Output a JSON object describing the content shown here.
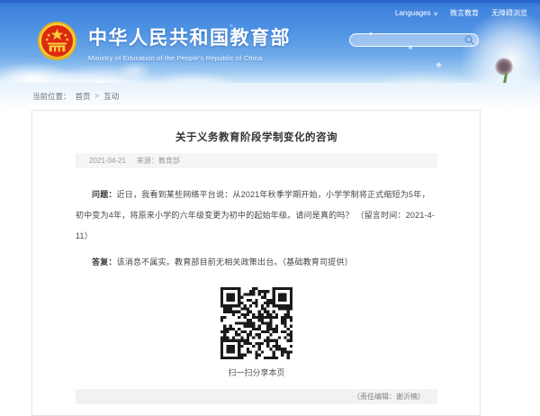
{
  "header": {
    "site_title": "中华人民共和国教育部",
    "site_subtitle": "Ministry of Education of the People's Republic of China",
    "links": {
      "languages": "Languages",
      "weiyan": "微言教育",
      "accessibility": "无障碍浏览"
    },
    "search": {
      "value": "",
      "placeholder": ""
    }
  },
  "breadcrumb": {
    "label": "当前位置：",
    "home": "首页",
    "separator": ">",
    "current": "互动"
  },
  "article": {
    "title": "关于义务教育阶段学制变化的咨询",
    "date": "2021-04-21",
    "source": "来源：教育部",
    "question_label": "问题：",
    "question_text": "近日，我看到某些网络平台说：从2021年秋季学期开始，小学学制将正式缩短为5年，初中变为4年，将原来小学的六年级变更为初中的起始年级。请问是真的吗？ （留言时间：2021-4-11）",
    "answer_label": "答复：",
    "answer_text": "该消息不属实。教育部目前无相关政策出台。（基础教育司提供）",
    "qr_caption": "扫一扫分享本页",
    "editor_note": "（责任编辑：谢沂楠）"
  },
  "colors": {
    "header_blue_top": "#2e6ed4",
    "header_blue_bottom": "#cfe7f8",
    "emblem_red": "#de2910",
    "emblem_gold": "#f7d03e",
    "meta_bar_bg": "#f5f5f5"
  }
}
